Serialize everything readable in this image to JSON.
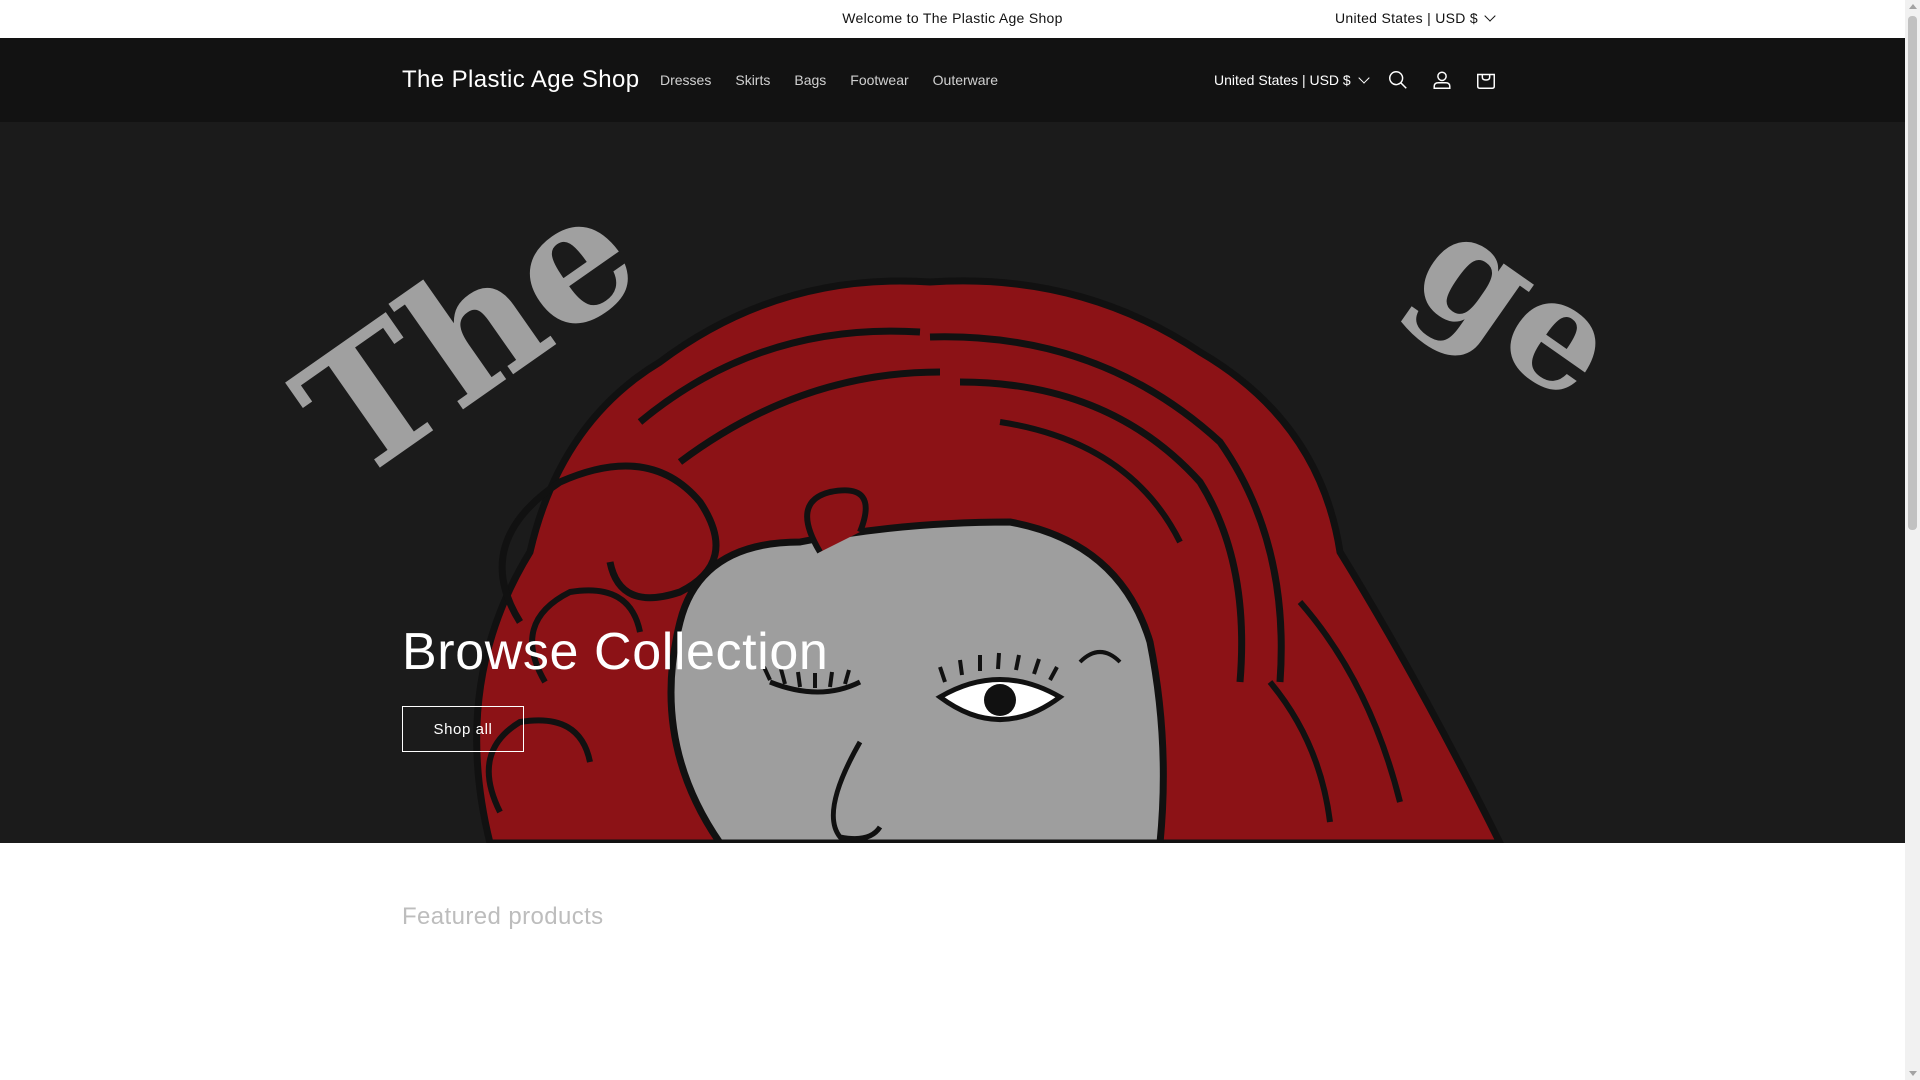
{
  "announcement": {
    "message": "Welcome to The Plastic Age Shop",
    "locale_label": "United States | USD $"
  },
  "header": {
    "logo": "The Plastic Age Shop",
    "nav": [
      "Dresses",
      "Skirts",
      "Bags",
      "Footwear",
      "Outerware"
    ],
    "locale_label": "United States | USD $",
    "icons": [
      "search-icon",
      "account-icon",
      "cart-icon"
    ]
  },
  "hero": {
    "title": "Browse Collection",
    "button_label": "Shop all",
    "colors": {
      "background": "#1a1a1a",
      "hair": "#8c1216",
      "face": "#9e9e9e",
      "lettering": "#a0a0a0"
    }
  },
  "featured": {
    "title": "Featured products"
  }
}
